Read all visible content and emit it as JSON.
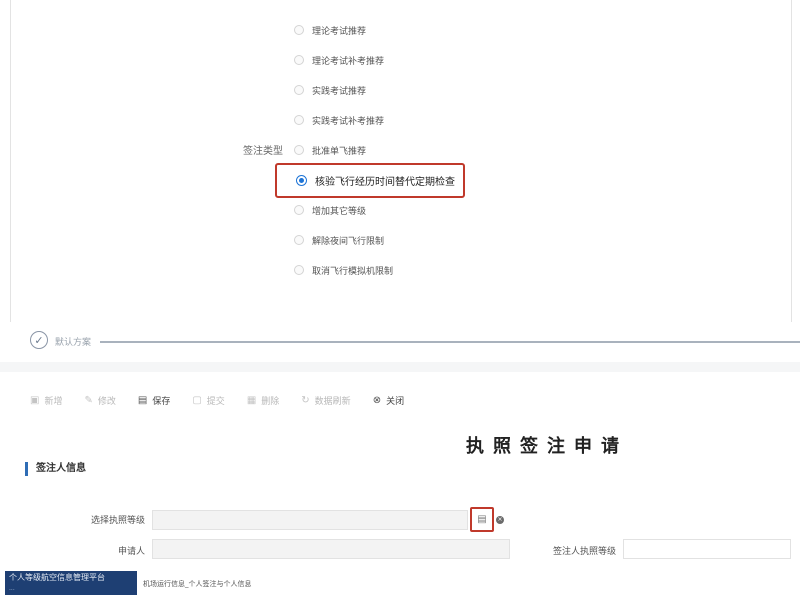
{
  "endorsement": {
    "field_label": "签注类型",
    "options": [
      {
        "label": "理论考试推荐",
        "selected": false
      },
      {
        "label": "理论考试补考推荐",
        "selected": false
      },
      {
        "label": "实践考试推荐",
        "selected": false
      },
      {
        "label": "实践考试补考推荐",
        "selected": false
      },
      {
        "label": "批准单飞推荐",
        "selected": false
      },
      {
        "label": "核验飞行经历时间替代定期检查",
        "selected": true
      },
      {
        "label": "增加其它等级",
        "selected": false
      },
      {
        "label": "解除夜间飞行限制",
        "selected": false
      },
      {
        "label": "取消飞行模拟机限制",
        "selected": false
      }
    ]
  },
  "step": {
    "label": "默认方案"
  },
  "toolbar": {
    "new_label": "新增",
    "edit_label": "修改",
    "save_label": "保存",
    "submit_label": "提交",
    "delete_label": "删除",
    "refresh_label": "数据刷新",
    "close_label": "关闭"
  },
  "form": {
    "title": "执照签注申请",
    "section_title": "签注人信息",
    "select_license_label": "选择执照等级",
    "applicant_label": "申请人",
    "endorser_license_label": "签注人执照等级",
    "select_license_value": "",
    "applicant_value": "",
    "endorser_license_value": ""
  },
  "footer": {
    "banner_title": "个人等级航空信息管理平台",
    "banner_sub": "...",
    "note": "机场运行信息_个人签注与个人信息"
  }
}
